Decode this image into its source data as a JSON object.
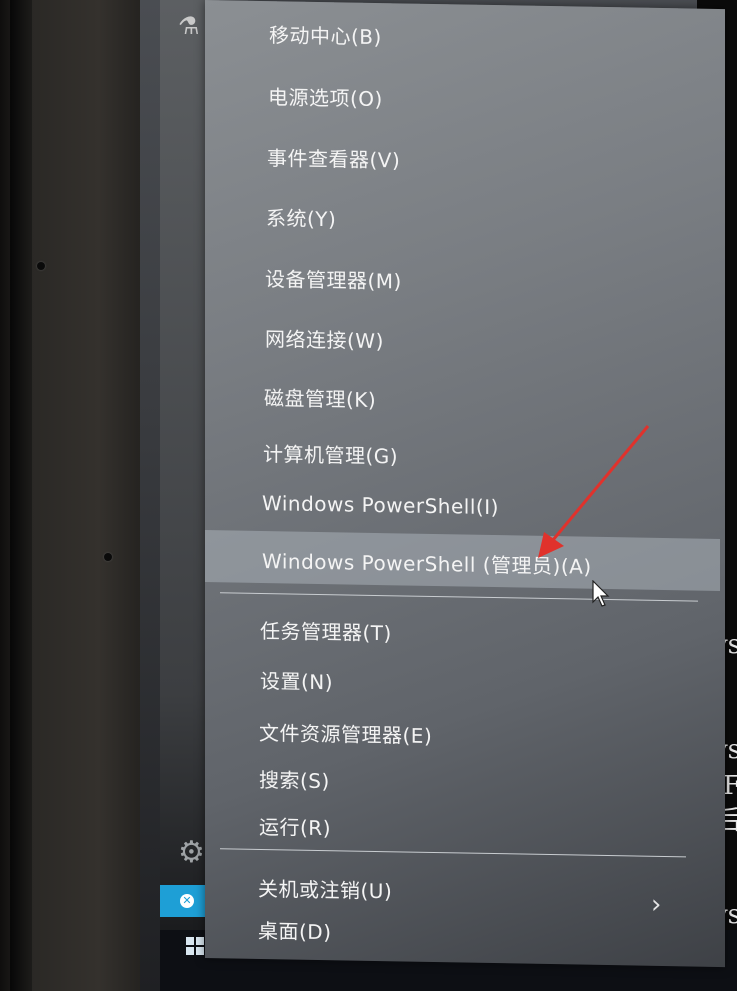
{
  "menu": {
    "items": [
      {
        "label": "移动中心(B)"
      },
      {
        "label": "电源选项(O)"
      },
      {
        "label": "事件查看器(V)"
      },
      {
        "label": "系统(Y)"
      },
      {
        "label": "设备管理器(M)"
      },
      {
        "label": "网络连接(W)"
      },
      {
        "label": "磁盘管理(K)"
      },
      {
        "label": "计算机管理(G)"
      },
      {
        "label": "Windows PowerShell(I)"
      },
      {
        "label": "Windows PowerShell (管理员)(A)"
      }
    ],
    "items2": [
      {
        "label": "任务管理器(T)"
      },
      {
        "label": "设置(N)"
      },
      {
        "label": "文件资源管理器(E)"
      },
      {
        "label": "搜索(S)"
      },
      {
        "label": "运行(R)"
      }
    ],
    "items3": [
      {
        "label": "关机或注销(U)"
      },
      {
        "label": "桌面(D)"
      }
    ]
  },
  "terminal_fragments": [
    "ys",
    "在F",
    "经后",
    "ys",
    "ys"
  ]
}
